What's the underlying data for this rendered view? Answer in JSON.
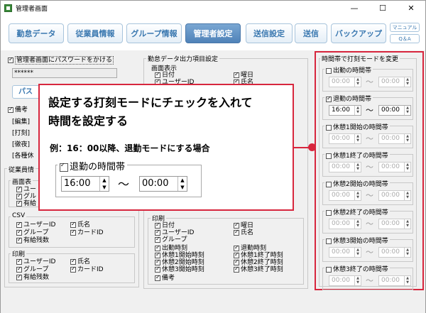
{
  "window": {
    "title": "管理者画面",
    "min": "—",
    "max": "☐",
    "close": "✕"
  },
  "toolbar": {
    "buttons": [
      "勤怠データ",
      "従業員情報",
      "グループ情報",
      "管理者設定",
      "送信設定",
      "送信",
      "バックアップ"
    ],
    "manual": "マニュアル",
    "qa": "Q＆A"
  },
  "left": {
    "password_label": "管理者画面にパスワードをかける",
    "password_value": "******",
    "pass_button": "パス",
    "biko": "備考",
    "rows": [
      "[編集]",
      "[打刻]",
      "[徹夜]",
      "[各種休"
    ],
    "employee_group": "従業員情",
    "screen_group": "画面表",
    "screen_items": [
      "ユー",
      "グル",
      "有給"
    ],
    "csv": "CSV",
    "csv_items": [
      "ユーザーID",
      "氏名",
      "グループ",
      "カードID",
      "有給残数"
    ],
    "print": "印刷",
    "print_items": [
      "ユーザーID",
      "氏名",
      "グループ",
      "カードID",
      "有給残数"
    ]
  },
  "middle": {
    "title": "勤怠データ出力項目設定",
    "screen": "画面表示",
    "screen_items": [
      "日付",
      "曜日",
      "ユーザーID",
      "氏名"
    ],
    "print": "印刷",
    "print_items": [
      "日付",
      "曜日",
      "ユーザーID",
      "氏名",
      "グループ",
      "出勤時刻",
      "退勤時刻",
      "休憩1開始時刻",
      "休憩1終了時刻",
      "休憩2開始時刻",
      "休憩2終了時刻",
      "休憩3開始時刻",
      "休憩3終了時刻",
      "備考"
    ]
  },
  "right": {
    "title": "時間帯で打刻モードを変更",
    "groups": [
      {
        "label": "出勤の時間帯",
        "checked": false,
        "from": "00:00",
        "to": "00:00"
      },
      {
        "label": "退勤の時間帯",
        "checked": true,
        "from": "16:00",
        "to": "00:00"
      },
      {
        "label": "休憩1開始の時間帯",
        "checked": false,
        "from": "00:00",
        "to": "00:00"
      },
      {
        "label": "休憩1終了の時間帯",
        "checked": false,
        "from": "00:00",
        "to": "00:00"
      },
      {
        "label": "休憩2開始の時間帯",
        "checked": false,
        "from": "00:00",
        "to": "00:00"
      },
      {
        "label": "休憩2終了の時間帯",
        "checked": false,
        "from": "00:00",
        "to": "00:00"
      },
      {
        "label": "休憩3開始の時間帯",
        "checked": false,
        "from": "00:00",
        "to": "00:00"
      },
      {
        "label": "休憩3終了の時間帯",
        "checked": false,
        "from": "00:00",
        "to": "00:00"
      }
    ],
    "tilde": "〜"
  },
  "callout": {
    "line1": "設定する打刻モードにチェックを入れて",
    "line2": "時間を設定する",
    "example": "例：16：00以降、退勤モードにする場合",
    "group_label": "退勤の時間帯",
    "from": "16:00",
    "to": "00:00",
    "tilde": "〜"
  },
  "colors": {
    "accent": "#d7263d",
    "button_text": "#3a78b0",
    "active_button": "#5a8cc2"
  }
}
